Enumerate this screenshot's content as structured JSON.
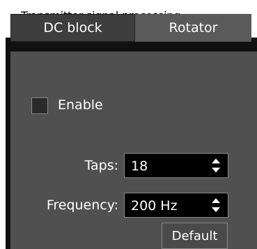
{
  "group_title": "Transmitter signal processing",
  "tabs": [
    {
      "label": "DC block"
    },
    {
      "label": "Rotator"
    }
  ],
  "enable_label": "Enable",
  "taps": {
    "label": "Taps:",
    "value": "18"
  },
  "frequency": {
    "label": "Frequency:",
    "value": "200 Hz"
  },
  "default_label": "Default"
}
